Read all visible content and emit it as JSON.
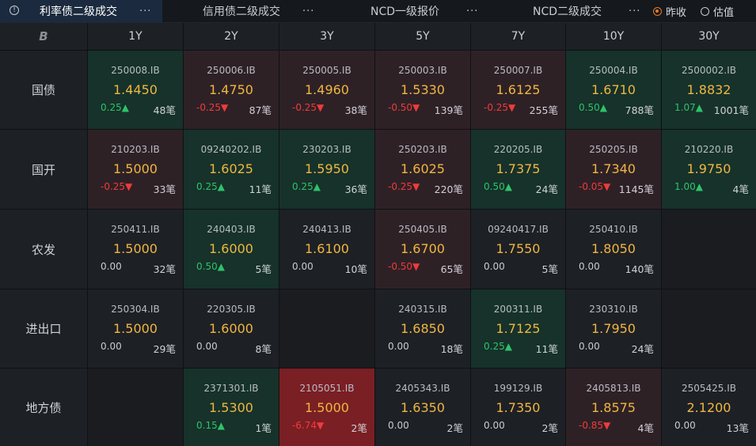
{
  "tabs": [
    {
      "label": "利率债二级成交",
      "more": "···"
    },
    {
      "label": "信用债二级成交",
      "more": "···"
    },
    {
      "label": "NCD一级报价",
      "more": "···"
    },
    {
      "label": "NCD二级成交",
      "more": "···"
    }
  ],
  "radios": [
    {
      "label": "昨收",
      "checked": true
    },
    {
      "label": "估值",
      "checked": false
    }
  ],
  "corner_logo": "B",
  "columns": [
    "1Y",
    "2Y",
    "3Y",
    "5Y",
    "7Y",
    "10Y",
    "30Y"
  ],
  "rows": [
    {
      "label": "国债",
      "cells": [
        {
          "code": "250008.IB",
          "rate": "1.4450",
          "chg": "0.25▲",
          "cnt": "48笔",
          "dir": "up"
        },
        {
          "code": "250006.IB",
          "rate": "1.4750",
          "chg": "-0.25▼",
          "cnt": "87笔",
          "dir": "down"
        },
        {
          "code": "250005.IB",
          "rate": "1.4960",
          "chg": "-0.25▼",
          "cnt": "38笔",
          "dir": "down"
        },
        {
          "code": "250003.IB",
          "rate": "1.5330",
          "chg": "-0.50▼",
          "cnt": "139笔",
          "dir": "down"
        },
        {
          "code": "250007.IB",
          "rate": "1.6125",
          "chg": "-0.25▼",
          "cnt": "255笔",
          "dir": "down"
        },
        {
          "code": "250004.IB",
          "rate": "1.6710",
          "chg": "0.50▲",
          "cnt": "788笔",
          "dir": "up"
        },
        {
          "code": "2500002.IB",
          "rate": "1.8832",
          "chg": "1.07▲",
          "cnt": "1001笔",
          "dir": "up"
        }
      ]
    },
    {
      "label": "国开",
      "cells": [
        {
          "code": "210203.IB",
          "rate": "1.5000",
          "chg": "-0.25▼",
          "cnt": "33笔",
          "dir": "down"
        },
        {
          "code": "09240202.IB",
          "rate": "1.6025",
          "chg": "0.25▲",
          "cnt": "11笔",
          "dir": "up"
        },
        {
          "code": "230203.IB",
          "rate": "1.5950",
          "chg": "0.25▲",
          "cnt": "36笔",
          "dir": "up"
        },
        {
          "code": "250203.IB",
          "rate": "1.6025",
          "chg": "-0.25▼",
          "cnt": "220笔",
          "dir": "down"
        },
        {
          "code": "220205.IB",
          "rate": "1.7375",
          "chg": "0.50▲",
          "cnt": "24笔",
          "dir": "up"
        },
        {
          "code": "250205.IB",
          "rate": "1.7340",
          "chg": "-0.05▼",
          "cnt": "1145笔",
          "dir": "down"
        },
        {
          "code": "210220.IB",
          "rate": "1.9750",
          "chg": "1.00▲",
          "cnt": "4笔",
          "dir": "up"
        }
      ]
    },
    {
      "label": "农发",
      "cells": [
        {
          "code": "250411.IB",
          "rate": "1.5000",
          "chg": "0.00",
          "cnt": "32笔",
          "dir": "flat"
        },
        {
          "code": "240403.IB",
          "rate": "1.6000",
          "chg": "0.50▲",
          "cnt": "5笔",
          "dir": "up"
        },
        {
          "code": "240413.IB",
          "rate": "1.6100",
          "chg": "0.00",
          "cnt": "10笔",
          "dir": "flat"
        },
        {
          "code": "250405.IB",
          "rate": "1.6700",
          "chg": "-0.50▼",
          "cnt": "65笔",
          "dir": "down"
        },
        {
          "code": "09240417.IB",
          "rate": "1.7550",
          "chg": "0.00",
          "cnt": "5笔",
          "dir": "flat"
        },
        {
          "code": "250410.IB",
          "rate": "1.8050",
          "chg": "0.00",
          "cnt": "140笔",
          "dir": "flat"
        },
        null
      ]
    },
    {
      "label": "进出口",
      "cells": [
        {
          "code": "250304.IB",
          "rate": "1.5000",
          "chg": "0.00",
          "cnt": "29笔",
          "dir": "flat"
        },
        {
          "code": "220305.IB",
          "rate": "1.6000",
          "chg": "0.00",
          "cnt": "8笔",
          "dir": "flat"
        },
        null,
        {
          "code": "240315.IB",
          "rate": "1.6850",
          "chg": "0.00",
          "cnt": "18笔",
          "dir": "flat"
        },
        {
          "code": "200311.IB",
          "rate": "1.7125",
          "chg": "0.25▲",
          "cnt": "11笔",
          "dir": "up"
        },
        {
          "code": "230310.IB",
          "rate": "1.7950",
          "chg": "0.00",
          "cnt": "24笔",
          "dir": "flat"
        },
        null
      ]
    },
    {
      "label": "地方债",
      "cells": [
        null,
        {
          "code": "2371301.IB",
          "rate": "1.5300",
          "chg": "0.15▲",
          "cnt": "1笔",
          "dir": "up"
        },
        {
          "code": "2105051.IB",
          "rate": "1.5000",
          "chg": "-6.74▼",
          "cnt": "2笔",
          "dir": "strong"
        },
        {
          "code": "2405343.IB",
          "rate": "1.6350",
          "chg": "0.00",
          "cnt": "2笔",
          "dir": "flat"
        },
        {
          "code": "199129.IB",
          "rate": "1.7350",
          "chg": "0.00",
          "cnt": "2笔",
          "dir": "flat"
        },
        {
          "code": "2405813.IB",
          "rate": "1.8575",
          "chg": "-0.85▼",
          "cnt": "4笔",
          "dir": "down"
        },
        {
          "code": "2505425.IB",
          "rate": "2.1200",
          "chg": "0.00",
          "cnt": "13笔",
          "dir": "flat"
        }
      ]
    }
  ],
  "colors": {
    "up": "#2fc26a",
    "down": "#ef3b3b",
    "rate": "#f0b642",
    "accent": "#e8792b"
  }
}
